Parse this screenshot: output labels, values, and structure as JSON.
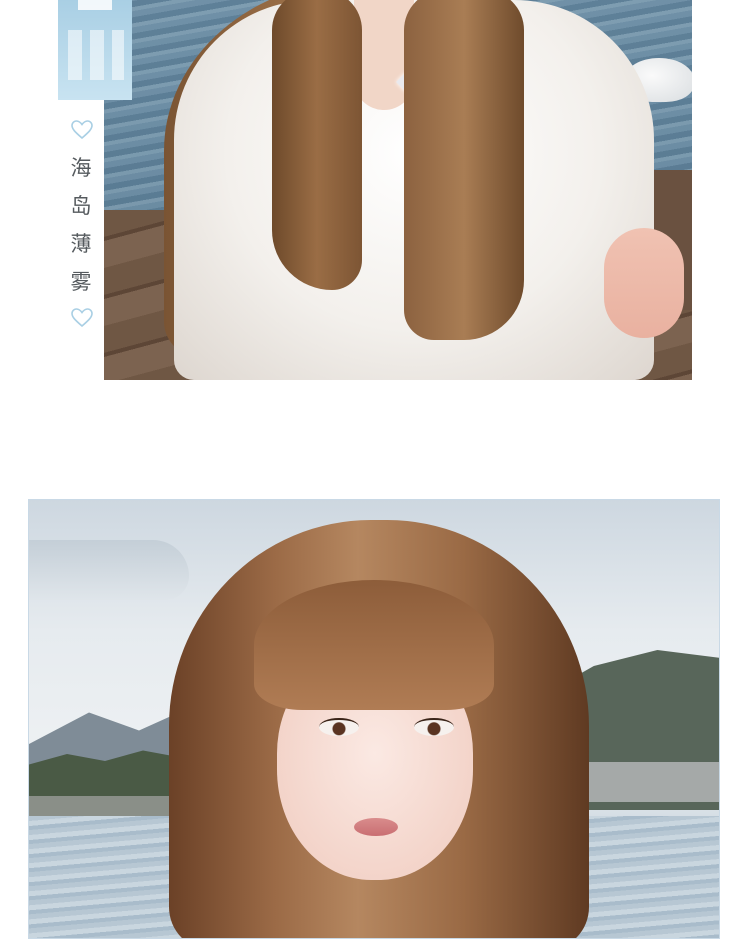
{
  "caption": {
    "characters": [
      "海",
      "岛",
      "薄",
      "雾"
    ],
    "accent_color": "#a9cfe4",
    "heart_icon": "heart-outline-icon"
  },
  "photos": [
    {
      "name": "photo-top-model-on-boat"
    },
    {
      "name": "photo-bottom-model-portrait-lakeside"
    }
  ]
}
